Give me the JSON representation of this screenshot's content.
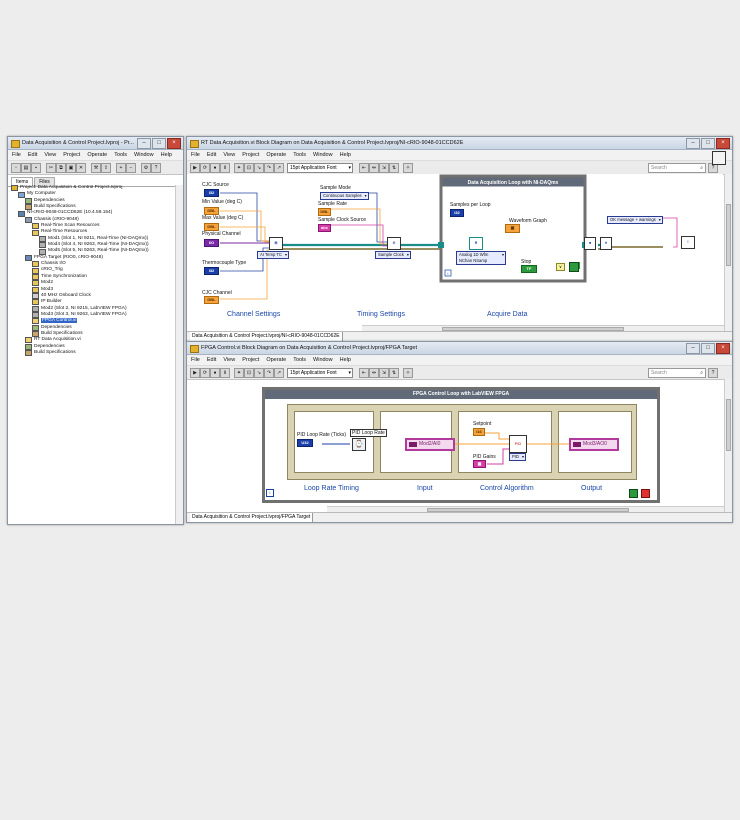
{
  "menu": [
    "File",
    "Edit",
    "View",
    "Project",
    "Operate",
    "Tools",
    "Window",
    "Help"
  ],
  "project_window": {
    "title": "Data Acquisition & Control Project.lvproj - Pr...",
    "tabs": [
      "Items",
      "Files"
    ],
    "tree": [
      {
        "label": "Project: Data Acquisition & Control Project.lvproj",
        "level": 0,
        "icon": "project-icon",
        "selected": false
      },
      {
        "label": "My Computer",
        "level": 1,
        "icon": "computer-icon",
        "selected": false
      },
      {
        "label": "Dependencies",
        "level": 2,
        "icon": "dependencies-icon",
        "selected": false
      },
      {
        "label": "Build Specifications",
        "level": 2,
        "icon": "build-specifications-icon",
        "selected": false
      },
      {
        "label": "NI-cRIO-9048-01CCD62E (10.4.59.154)",
        "level": 1,
        "icon": "crio-target-icon",
        "selected": false
      },
      {
        "label": "Chassis (cRIO-9048)",
        "level": 2,
        "icon": "chassis-icon",
        "selected": false
      },
      {
        "label": "Real-Time Scan Resources",
        "level": 3,
        "icon": "folder-icon",
        "selected": false
      },
      {
        "label": "Real-Time Resources",
        "level": 3,
        "icon": "folder-icon",
        "selected": false
      },
      {
        "label": "Mod1 (Slot 1, NI 9211, Real-Time (NI-DAQmx))",
        "level": 4,
        "icon": "module-icon",
        "selected": false
      },
      {
        "label": "Mod4 (Slot 4, NI 9263, Real-Time (NI-DAQmx))",
        "level": 4,
        "icon": "module-icon",
        "selected": false
      },
      {
        "label": "Mod5 (Slot 5, NI 9263, Real-Time (NI-DAQmx))",
        "level": 4,
        "icon": "module-icon",
        "selected": false
      },
      {
        "label": "FPGA Target (RIO0, cRIO-9048)",
        "level": 2,
        "icon": "fpga-target-icon",
        "selected": false
      },
      {
        "label": "Chassis I/O",
        "level": 3,
        "icon": "folder-icon",
        "selected": false
      },
      {
        "label": "cRIO_Trig",
        "level": 3,
        "icon": "folder-icon",
        "selected": false
      },
      {
        "label": "Time Synchronization",
        "level": 3,
        "icon": "folder-icon",
        "selected": false
      },
      {
        "label": "Mod2",
        "level": 3,
        "icon": "folder-icon",
        "selected": false
      },
      {
        "label": "Mod3",
        "level": 3,
        "icon": "folder-icon",
        "selected": false
      },
      {
        "label": "40 MHz Onboard Clock",
        "level": 3,
        "icon": "clock-icon",
        "selected": false
      },
      {
        "label": "IP Builder",
        "level": 3,
        "icon": "folder-icon",
        "selected": false
      },
      {
        "label": "Mod2 (Slot 2, NI 9215, LabVIEW FPGA)",
        "level": 3,
        "icon": "module-icon",
        "selected": false
      },
      {
        "label": "Mod3 (Slot 3, NI 9263, LabVIEW FPGA)",
        "level": 3,
        "icon": "module-icon",
        "selected": false
      },
      {
        "label": "FPGA Control.vi",
        "level": 3,
        "icon": "vi-icon",
        "selected": true
      },
      {
        "label": "Dependencies",
        "level": 3,
        "icon": "dependencies-icon",
        "selected": false
      },
      {
        "label": "Build Specifications",
        "level": 3,
        "icon": "build-specifications-icon",
        "selected": false
      },
      {
        "label": "RT Data Acquisition.vi",
        "level": 2,
        "icon": "vi-icon",
        "selected": false
      },
      {
        "label": "Dependencies",
        "level": 2,
        "icon": "dependencies-icon",
        "selected": false
      },
      {
        "label": "Build Specifications",
        "level": 2,
        "icon": "build-specifications-icon",
        "selected": false
      }
    ]
  },
  "rt_window": {
    "title": "RT Data Acquisition.vi Block Diagram on Data Acquisition & Control Project.lvproj/NI-cRIO-9048-01CCD62E",
    "font": "15pt Application Font",
    "search_placeholder": "Search",
    "status_path": "Data Acquisition & Control Project.lvproj/NI-cRIO-9048-01CCD62E",
    "labels": {
      "cjc_source": "CJC Source",
      "min_value": "Min Value (deg C)",
      "max_value": "Max Value (deg C)",
      "physical_channel": "Physical Channel",
      "thermocouple_type": "Thermocouple Type",
      "cjc_channel": "CJC Channel",
      "sample_mode": "Sample Mode",
      "sample_rate": "Sample Rate",
      "sample_clock_source": "Sample Clock Source",
      "loop_title": "Data Acquisition Loop with NI-DAQmx",
      "samples_per_loop": "Samples per Loop",
      "waveform_graph": "Waveform Graph",
      "stop": "Stop"
    },
    "enums": {
      "continuous_samples": "Continuous Samples",
      "ai_temp_tc": "AI Temp TC",
      "sample_clock": "Sample Clock",
      "analog_1d_wfm": "Analog 1D Wfm",
      "nchan_nsamp": "NChan NSamp",
      "ok_message": "OK message + warnings"
    },
    "sections": [
      "Channel Settings",
      "Timing Settings",
      "Acquire Data"
    ]
  },
  "fpga_window": {
    "title": "FPGA Control.vi Block Diagram on Data Acquisition & Control Project.lvproj/FPGA Target",
    "font": "15pt Application Font",
    "status_path": "Data Acquisition & Control Project.lvproj/FPGA Target",
    "loop_title": "FPGA Control Loop with LabVIEW FPGA",
    "labels": {
      "pid_loop_rate": "PID Loop Rate (Ticks)",
      "pid_loop_rate_node": "PID Loop Rate",
      "setpoint": "Setpoint",
      "pid_gains": "PID Gains",
      "mod2_ai0": "Mod2/AI0",
      "mod3_ao0": "Mod3/AO0",
      "pid": "PID"
    },
    "sections": [
      "Loop Rate Timing",
      "Input",
      "Control Algorithm",
      "Output"
    ]
  },
  "colors": {
    "accent_blue": "#1c47a8",
    "wire_orange": "#f5a33a",
    "wire_pink": "#d53ea7",
    "wire_blue": "#1a3fa8",
    "wire_green": "#2c9a3c",
    "selection": "#3166c6"
  }
}
